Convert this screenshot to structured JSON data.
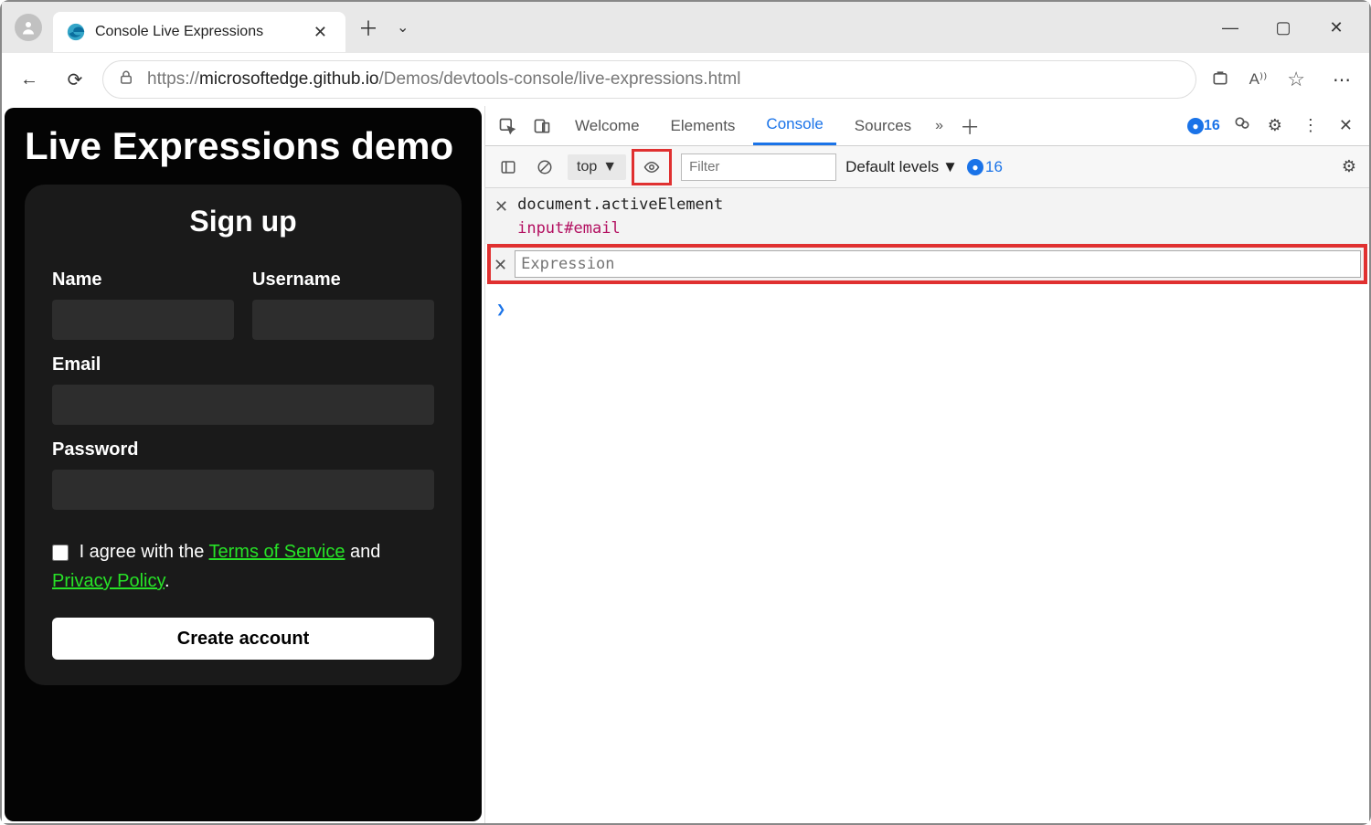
{
  "browser": {
    "tab_title": "Console Live Expressions",
    "url_prefix": "https://",
    "url_host": "microsoftedge.github.io",
    "url_path": "/Demos/devtools-console/live-expressions.html"
  },
  "page": {
    "title": "Live Expressions demo",
    "signup": "Sign up",
    "labels": {
      "name": "Name",
      "username": "Username",
      "email": "Email",
      "password": "Password"
    },
    "agree_prefix": "I agree with the ",
    "tos": "Terms of Service",
    "agree_mid": " and ",
    "privacy": "Privacy Policy",
    "agree_suffix": ".",
    "create": "Create account"
  },
  "devtools": {
    "tabs": {
      "welcome": "Welcome",
      "elements": "Elements",
      "console": "Console",
      "sources": "Sources"
    },
    "issue_count": "16",
    "toolbar": {
      "context": "top",
      "filter_placeholder": "Filter",
      "levels": "Default levels",
      "issues": "16"
    },
    "live_expr1": {
      "expr": "document.activeElement",
      "result": "input#email"
    },
    "live_expr2_placeholder": "Expression",
    "prompt": ">"
  }
}
